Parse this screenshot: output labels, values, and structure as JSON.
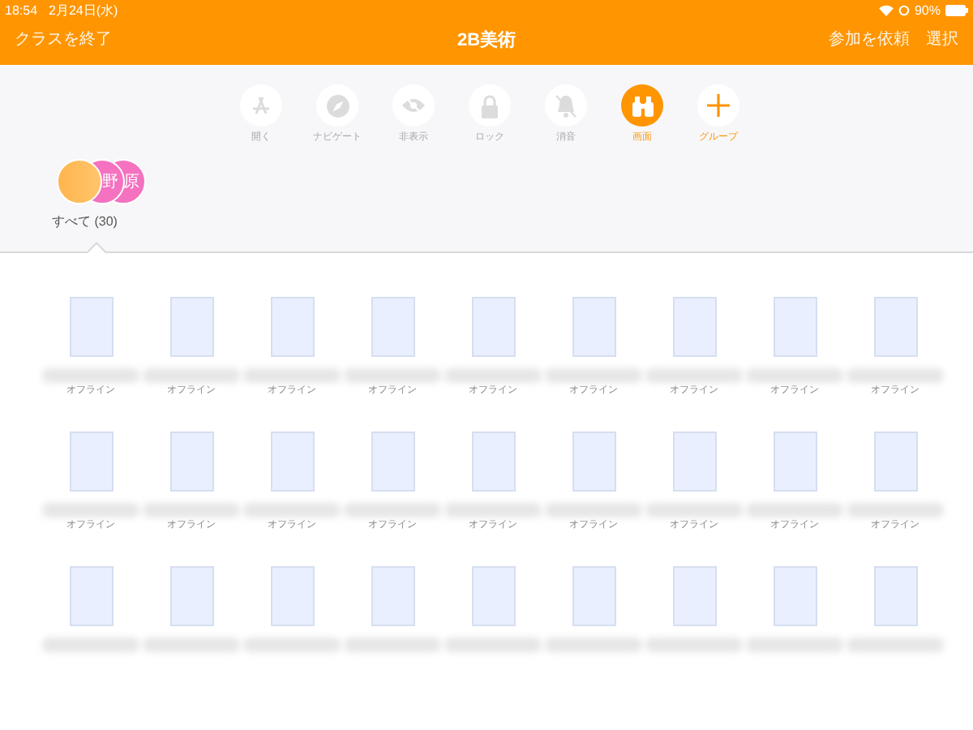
{
  "status_bar": {
    "time": "18:54",
    "date": "2月24日(水)",
    "battery": "90%"
  },
  "nav": {
    "left": "クラスを終了",
    "title": "2B美術",
    "right": [
      "参加を依頼",
      "選択"
    ]
  },
  "actions": [
    {
      "kind": "open",
      "label": "開く",
      "enabled": false
    },
    {
      "kind": "navigate",
      "label": "ナビゲート",
      "enabled": false
    },
    {
      "kind": "hide",
      "label": "非表示",
      "enabled": false
    },
    {
      "kind": "lock",
      "label": "ロック",
      "enabled": false
    },
    {
      "kind": "mute",
      "label": "消音",
      "enabled": false
    },
    {
      "kind": "screen",
      "label": "画面",
      "enabled": true
    },
    {
      "kind": "group",
      "label": "グループ",
      "enabled": true
    }
  ],
  "groups": [
    {
      "label": "すべて (30)",
      "selected": true,
      "avatars": [
        "野",
        "原"
      ]
    }
  ],
  "student_rows": [
    [
      {
        "status": "オフライン"
      },
      {
        "status": "オフライン"
      },
      {
        "status": "オフライン"
      },
      {
        "status": "オフライン"
      },
      {
        "status": "オフライン"
      },
      {
        "status": "オフライン"
      },
      {
        "status": "オフライン"
      },
      {
        "status": "オフライン"
      },
      {
        "status": "オフライン"
      }
    ],
    [
      {
        "status": "オフライン"
      },
      {
        "status": "オフライン"
      },
      {
        "status": "オフライン"
      },
      {
        "status": "オフライン"
      },
      {
        "status": "オフライン"
      },
      {
        "status": "オフライン"
      },
      {
        "status": "オフライン"
      },
      {
        "status": "オフライン"
      },
      {
        "status": "オフライン"
      }
    ],
    [
      {},
      {},
      {},
      {},
      {},
      {},
      {},
      {},
      {}
    ]
  ]
}
